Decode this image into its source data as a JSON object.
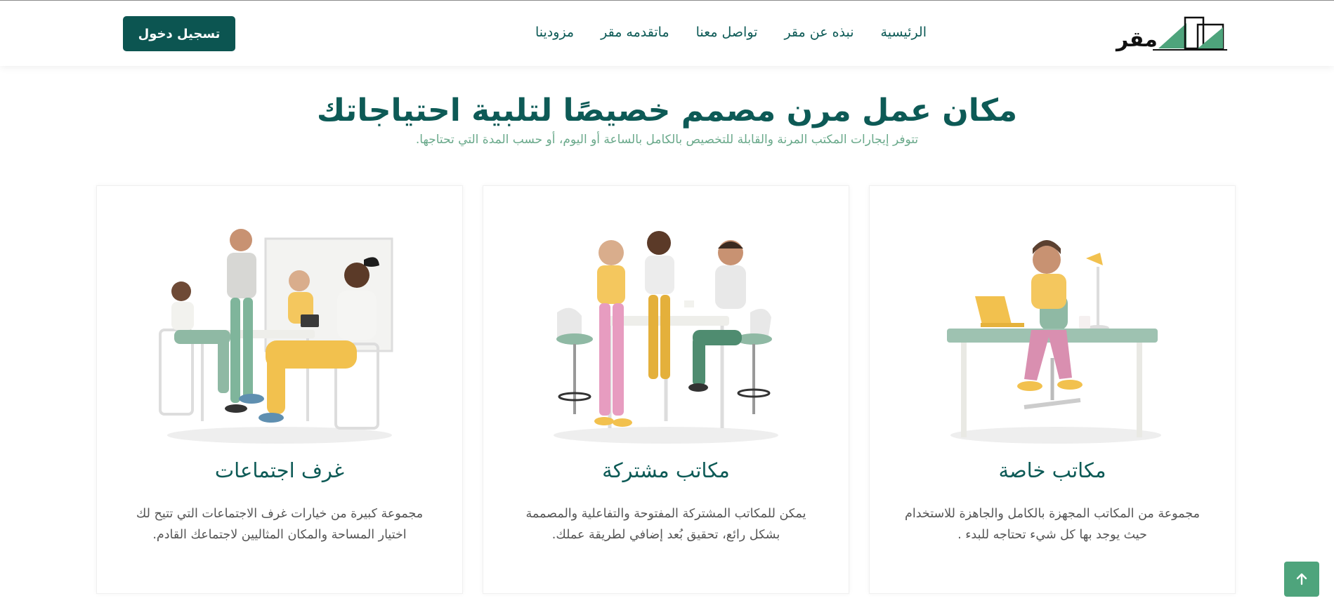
{
  "brand": {
    "name": "مقر"
  },
  "nav": {
    "items": [
      "الرئيسية",
      "نبذه عن مقر",
      "تواصل معنا",
      "ماتقدمه مقر",
      "مزودينا"
    ]
  },
  "login_label": "تسجيل دخول",
  "hero": {
    "title": "مكان عمل مرن مصمم خصيصًا لتلبية احتياجاتك",
    "subtitle": "تتوفر إيجارات المكتب المرنة والقابلة للتخصيص بالكامل بالساعة أو اليوم، أو حسب المدة التي تحتاجها."
  },
  "cards": [
    {
      "title": "مكاتب خاصة",
      "text": "مجموعة من المكاتب المجهزة بالكامل والجاهزة للاستخدام حيث يوجد بها كل شيء تحتاجه للبدء ."
    },
    {
      "title": "مكاتب مشتركة",
      "text": "يمكن للمكاتب المشتركة المفتوحة والتفاعلية والمصممة بشكل رائع، تحقيق بُعد إضافي لطريقة عملك."
    },
    {
      "title": "غرف اجتماعات",
      "text": "مجموعة كبيرة من خيارات غرف الاجتماعات التي تتيح لك اختيار المساحة والمكان المثاليين لاجتماعك القادم."
    }
  ],
  "colors": {
    "primary": "#0c5551",
    "accent": "#4ea47c",
    "subtitle": "#6aa98b"
  },
  "icons": {
    "scroll_top": "arrow-up-icon"
  }
}
